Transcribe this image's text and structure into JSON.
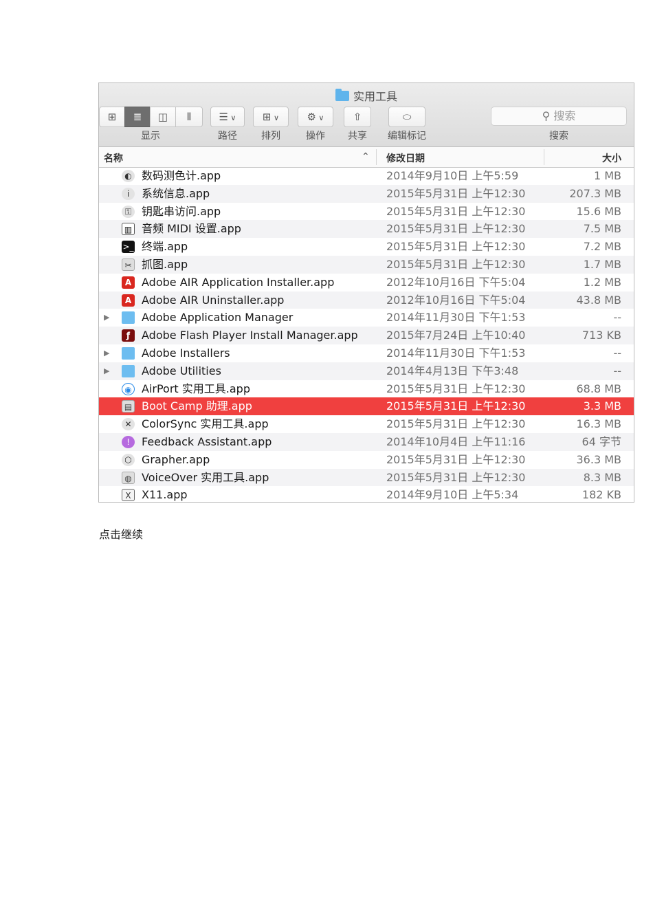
{
  "window": {
    "title": "实用工具"
  },
  "toolbar": {
    "view_icons": [
      "icon-view-icon",
      "list-view-icon",
      "column-view-icon",
      "coverflow-view-icon"
    ],
    "view_label": "显示",
    "path_label": "路径",
    "arrange_label": "排列",
    "action_label": "操作",
    "share_label": "共享",
    "tags_label": "编辑标记",
    "search_placeholder": "搜索",
    "search_label": "搜索"
  },
  "columns": {
    "name": "名称",
    "date": "修改日期",
    "size": "大小",
    "sort_indicator": "^"
  },
  "rows": [
    {
      "name": "数码测色计.app",
      "date": "2014年9月10日 上午5:59",
      "size": "1 MB",
      "icon": "colormeter-icon",
      "glyph": "◐",
      "disclosure": ""
    },
    {
      "name": "系统信息.app",
      "date": "2015年5月31日 上午12:30",
      "size": "207.3 MB",
      "icon": "system-info-icon",
      "glyph": "i",
      "disclosure": ""
    },
    {
      "name": "钥匙串访问.app",
      "date": "2015年5月31日 上午12:30",
      "size": "15.6 MB",
      "icon": "keychain-icon",
      "glyph": "⚿",
      "disclosure": ""
    },
    {
      "name": "音频 MIDI 设置.app",
      "date": "2015年5月31日 上午12:30",
      "size": "7.5 MB",
      "icon": "midi-icon",
      "glyph": "▥",
      "disclosure": ""
    },
    {
      "name": "终端.app",
      "date": "2015年5月31日 上午12:30",
      "size": "7.2 MB",
      "icon": "terminal-icon",
      "glyph": ">_",
      "disclosure": ""
    },
    {
      "name": "抓图.app",
      "date": "2015年5月31日 上午12:30",
      "size": "1.7 MB",
      "icon": "grab-icon",
      "glyph": "✂",
      "disclosure": ""
    },
    {
      "name": "Adobe AIR Application Installer.app",
      "date": "2012年10月16日 下午5:04",
      "size": "1.2 MB",
      "icon": "adobe-air-icon",
      "glyph": "A",
      "disclosure": ""
    },
    {
      "name": "Adobe AIR Uninstaller.app",
      "date": "2012年10月16日 下午5:04",
      "size": "43.8 MB",
      "icon": "adobe-air-icon",
      "glyph": "A",
      "disclosure": ""
    },
    {
      "name": "Adobe Application Manager",
      "date": "2014年11月30日 下午1:53",
      "size": "--",
      "icon": "folder-icon",
      "glyph": "",
      "disclosure": "▶"
    },
    {
      "name": "Adobe Flash Player Install Manager.app",
      "date": "2015年7月24日 上午10:40",
      "size": "713 KB",
      "icon": "flash-icon",
      "glyph": "ƒ",
      "disclosure": ""
    },
    {
      "name": "Adobe Installers",
      "date": "2014年11月30日 下午1:53",
      "size": "--",
      "icon": "folder-icon",
      "glyph": "",
      "disclosure": "▶"
    },
    {
      "name": "Adobe Utilities",
      "date": "2014年4月13日 下午3:48",
      "size": "--",
      "icon": "folder-icon",
      "glyph": "",
      "disclosure": "▶"
    },
    {
      "name": "AirPort 实用工具.app",
      "date": "2015年5月31日 上午12:30",
      "size": "68.8 MB",
      "icon": "airport-icon",
      "glyph": "◉",
      "disclosure": ""
    },
    {
      "name": "Boot Camp 助理.app",
      "date": "2015年5月31日 上午12:30",
      "size": "3.3 MB",
      "icon": "bootcamp-icon",
      "glyph": "▤",
      "disclosure": "",
      "selected": true
    },
    {
      "name": "ColorSync 实用工具.app",
      "date": "2015年5月31日 上午12:30",
      "size": "16.3 MB",
      "icon": "colorsync-icon",
      "glyph": "✕",
      "disclosure": ""
    },
    {
      "name": "Feedback Assistant.app",
      "date": "2014年10月4日 上午11:16",
      "size": "64 字节",
      "icon": "feedback-icon",
      "glyph": "!",
      "disclosure": ""
    },
    {
      "name": "Grapher.app",
      "date": "2015年5月31日 上午12:30",
      "size": "36.3 MB",
      "icon": "grapher-icon",
      "glyph": "⬡",
      "disclosure": ""
    },
    {
      "name": "VoiceOver 实用工具.app",
      "date": "2015年5月31日 上午12:30",
      "size": "8.3 MB",
      "icon": "voiceover-icon",
      "glyph": "◍",
      "disclosure": ""
    },
    {
      "name": "X11.app",
      "date": "2014年9月10日 上午5:34",
      "size": "182 KB",
      "icon": "x11-icon",
      "glyph": "X",
      "disclosure": ""
    }
  ],
  "caption": "点击继续",
  "colors": {
    "selection": "#f0403f",
    "folder": "#6dbdf0",
    "toolbar": "#e4e4e4"
  }
}
